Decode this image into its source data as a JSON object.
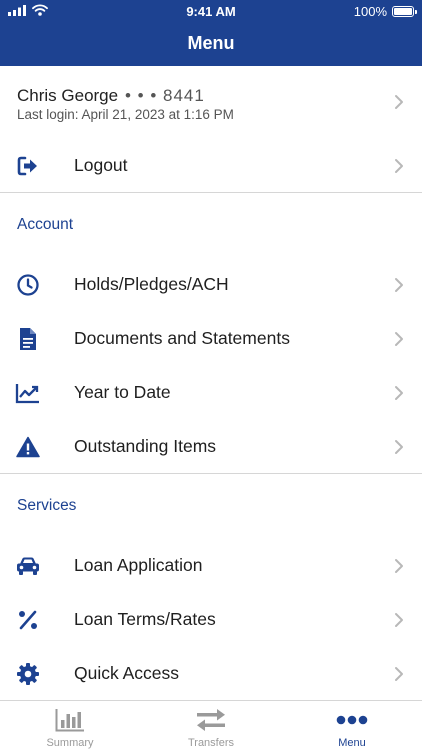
{
  "status_bar": {
    "time": "9:41 AM",
    "battery": "100%"
  },
  "header": {
    "title": "Menu"
  },
  "profile": {
    "name": "Chris George",
    "account_mask": "• • •  8441",
    "last_login": "Last login: April 21, 2023 at 1:16 PM"
  },
  "logout": {
    "label": "Logout",
    "icon": "logout-icon"
  },
  "account": {
    "title": "Account",
    "items": [
      {
        "label": "Holds/Pledges/ACH",
        "icon": "clock-icon"
      },
      {
        "label": "Documents and Statements",
        "icon": "document-icon"
      },
      {
        "label": "Year to Date",
        "icon": "chart-icon"
      },
      {
        "label": "Outstanding Items",
        "icon": "warning-icon"
      }
    ]
  },
  "services": {
    "title": "Services",
    "items": [
      {
        "label": "Loan Application",
        "icon": "car-icon"
      },
      {
        "label": "Loan Terms/Rates",
        "icon": "percent-icon"
      },
      {
        "label": "Quick Access",
        "icon": "gear-icon"
      }
    ]
  },
  "tabbar": {
    "tabs": [
      {
        "label": "Summary",
        "icon": "bar-chart-icon",
        "active": false
      },
      {
        "label": "Transfers",
        "icon": "transfer-arrows-icon",
        "active": false
      },
      {
        "label": "Menu",
        "icon": "more-dots-icon",
        "active": true
      }
    ]
  },
  "colors": {
    "brand": "#1d4291",
    "divider": "#d6d6d6",
    "inactive_tab": "#9a9a9a"
  }
}
